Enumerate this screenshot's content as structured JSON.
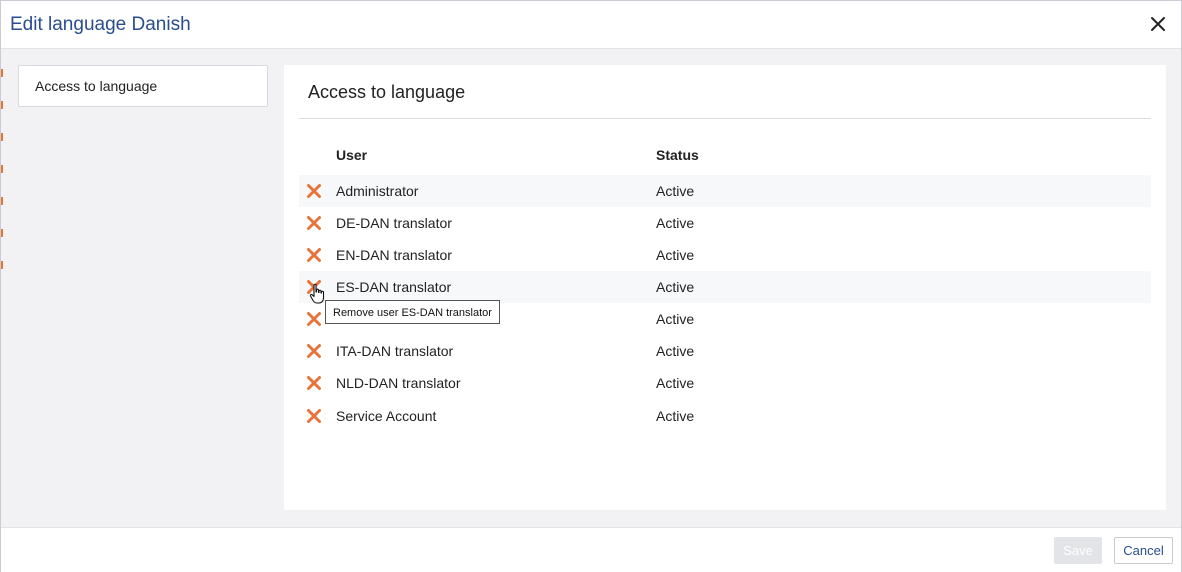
{
  "dialog": {
    "title": "Edit language Danish",
    "close_icon": "close-icon"
  },
  "sidebar": {
    "items": [
      {
        "label": "Access to language"
      }
    ]
  },
  "panel": {
    "title": "Access to language",
    "columns": {
      "user": "User",
      "status": "Status"
    },
    "rows": [
      {
        "user": "Administrator",
        "status": "Active"
      },
      {
        "user": "DE-DAN translator",
        "status": "Active"
      },
      {
        "user": "EN-DAN translator",
        "status": "Active"
      },
      {
        "user": "ES-DAN translator",
        "status": "Active"
      },
      {
        "user": "",
        "status": "Active"
      },
      {
        "user": "ITA-DAN translator",
        "status": "Active"
      },
      {
        "user": "NLD-DAN translator",
        "status": "Active"
      },
      {
        "user": "Service Account",
        "status": "Active"
      }
    ],
    "remove_icon": "remove-x-icon",
    "remove_color": "#e8743b"
  },
  "tooltip": {
    "text": "Remove user ES-DAN translator"
  },
  "footer": {
    "save_label": "Save",
    "cancel_label": "Cancel"
  },
  "colors": {
    "accent": "#2a4d8f",
    "remove": "#e8743b",
    "save_disabled": "#e3e4e7"
  }
}
